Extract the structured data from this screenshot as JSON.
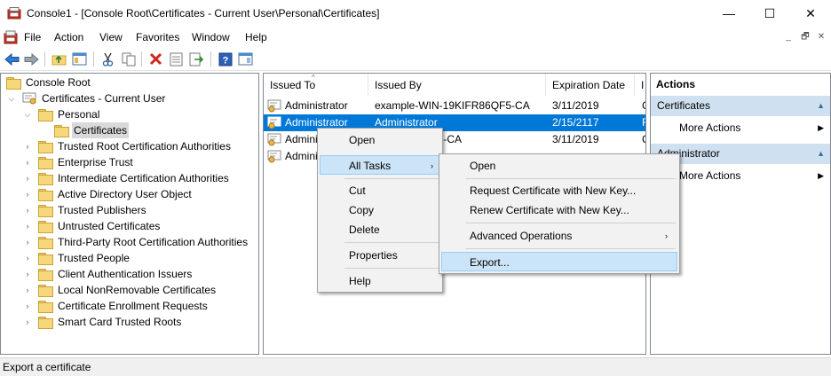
{
  "window": {
    "title": "Console1 - [Console Root\\Certificates - Current User\\Personal\\Certificates]",
    "minimize": "—",
    "maximize": "☐",
    "close": "✕"
  },
  "menu": {
    "file": "File",
    "action": "Action",
    "view": "View",
    "favorites": "Favorites",
    "window": "Window",
    "help": "Help"
  },
  "mdi": {
    "minimize": "_",
    "restore": "🗗",
    "close": "✕"
  },
  "toolbar": {
    "icons": [
      "back-arrow-icon",
      "forward-arrow-icon",
      "up-folder-icon",
      "show-hide-tree-icon",
      "cut-icon",
      "copy-icon",
      "delete-icon",
      "properties-icon",
      "export-list-icon",
      "help-icon",
      "action-pane-icon"
    ]
  },
  "tree": {
    "root": "Console Root",
    "certs_current_user": "Certificates - Current User",
    "personal": "Personal",
    "certificates": "Certificates",
    "folders": [
      "Trusted Root Certification Authorities",
      "Enterprise Trust",
      "Intermediate Certification Authorities",
      "Active Directory User Object",
      "Trusted Publishers",
      "Untrusted Certificates",
      "Third-Party Root Certification Authorities",
      "Trusted People",
      "Client Authentication Issuers",
      "Local NonRemovable Certificates",
      "Certificate Enrollment Requests",
      "Smart Card Trusted Roots"
    ]
  },
  "list": {
    "columns": [
      "Issued To",
      "Issued By",
      "Expiration Date",
      "I"
    ],
    "rows": [
      {
        "issued_to": "Administrator",
        "issued_by": "example-WIN-19KIFR86QF5-CA",
        "expiration": "3/11/2019",
        "extra": "C",
        "selected": false
      },
      {
        "issued_to": "Administrator",
        "issued_by": "Administrator",
        "expiration": "2/15/2117",
        "extra": "F",
        "selected": true
      },
      {
        "issued_to": "Administr",
        "issued_by": "19KIFR86QF5-CA",
        "expiration": "3/11/2019",
        "extra": "C",
        "selected": false
      },
      {
        "issued_to": "Admini",
        "issued_by": "",
        "expiration": "",
        "extra": "",
        "selected": false
      }
    ]
  },
  "actions": {
    "header": "Actions",
    "section1": "Certificates",
    "more_actions_1": "More Actions",
    "section2": "Administrator",
    "more_actions_2": "More Actions"
  },
  "context_menu": {
    "open": "Open",
    "all_tasks": "All Tasks",
    "cut": "Cut",
    "copy": "Copy",
    "delete": "Delete",
    "properties": "Properties",
    "help": "Help"
  },
  "submenu": {
    "open": "Open",
    "request_new_key": "Request Certificate with New Key...",
    "renew_new_key": "Renew Certificate with New Key...",
    "advanced": "Advanced Operations",
    "export": "Export..."
  },
  "status": {
    "text": "Export a certificate"
  },
  "colors": {
    "selection": "#0078d7",
    "highlight": "#cce4f7",
    "section": "#cfe0f0"
  }
}
